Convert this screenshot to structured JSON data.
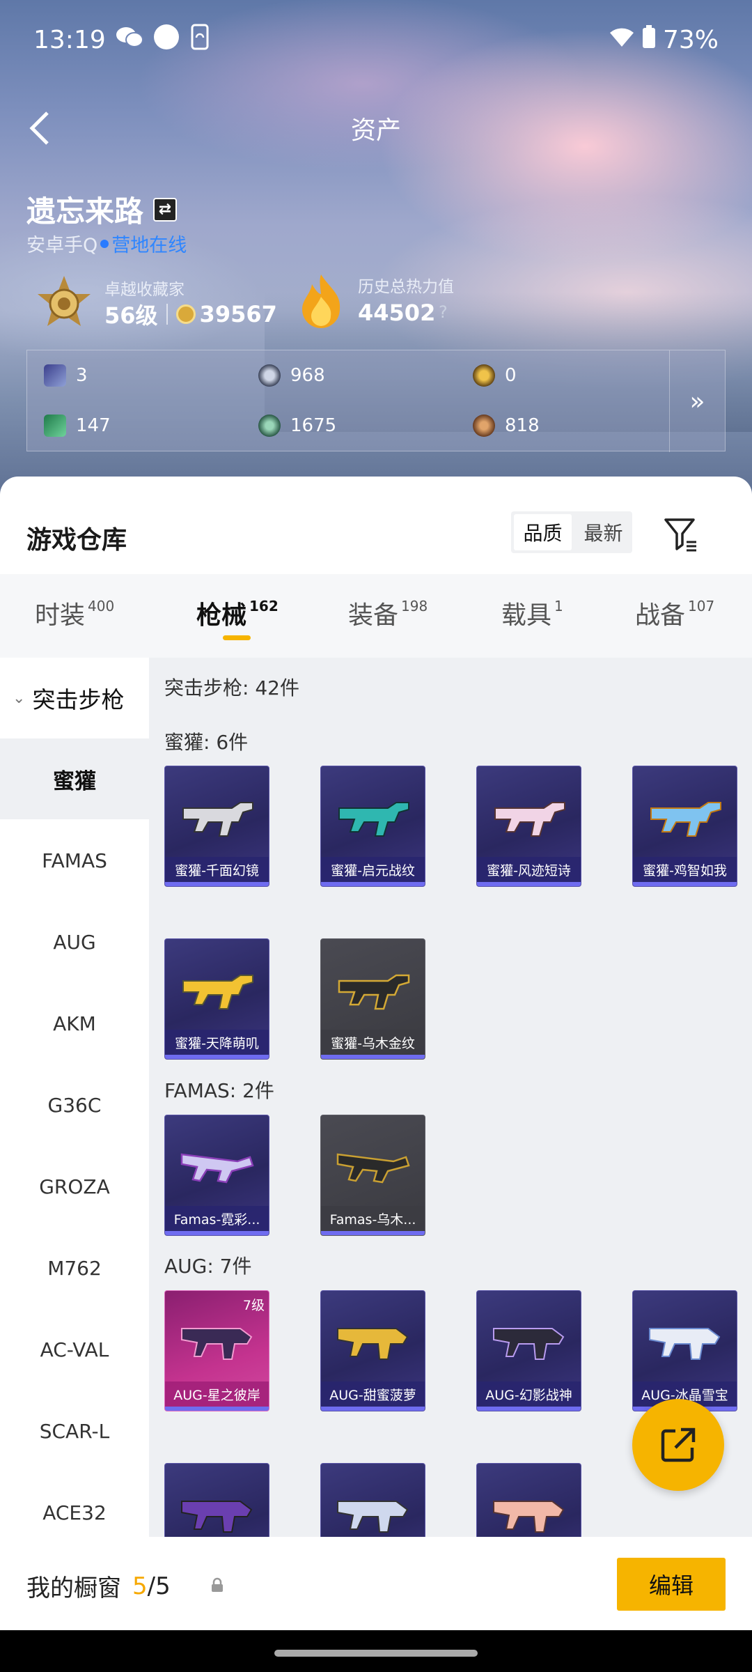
{
  "status_bar": {
    "time": "13:19",
    "battery": "73%"
  },
  "header": {
    "title": "资产"
  },
  "profile": {
    "name": "遗忘来路",
    "platform": "安卓手Q",
    "online_status": "营地在线",
    "rank_caption": "卓越收藏家",
    "rank_level": "56级",
    "coins": "39567",
    "heat_caption": "历史总热力值",
    "heat_value": "44502",
    "heat_help": "?"
  },
  "stats": [
    {
      "icon": "card-icon",
      "value": "3"
    },
    {
      "icon": "silver-token-icon",
      "value": "968"
    },
    {
      "icon": "gold-token-icon",
      "value": "0"
    },
    {
      "icon": "ticket-icon",
      "value": "147"
    },
    {
      "icon": "green-orb-icon",
      "value": "1675"
    },
    {
      "icon": "bronze-orb-icon",
      "value": "818"
    }
  ],
  "warehouse": {
    "title": "游戏仓库",
    "sort_options": [
      "品质",
      "最新"
    ],
    "sort_selected": "品质"
  },
  "tabs": [
    {
      "label": "时装",
      "count": "400"
    },
    {
      "label": "枪械",
      "count": "162"
    },
    {
      "label": "装备",
      "count": "198"
    },
    {
      "label": "载具",
      "count": "1"
    },
    {
      "label": "战备",
      "count": "107"
    }
  ],
  "sidebar": {
    "category": "突击步枪",
    "items": [
      "蜜獾",
      "FAMAS",
      "AUG",
      "AKM",
      "G36C",
      "GROZA",
      "M762",
      "AC-VAL",
      "SCAR-L",
      "ACE32"
    ]
  },
  "content": {
    "category_count": "突击步枪: 42件",
    "groups": [
      {
        "heading": "蜜獾: 6件",
        "items": [
          "蜜獾-千面幻镜",
          "蜜獾-启元战纹",
          "蜜獾-风迹短诗",
          "蜜獾-鸡智如我",
          "蜜獾-天降萌叽",
          "蜜獾-乌木金纹"
        ]
      },
      {
        "heading": "FAMAS: 2件",
        "items": [
          "Famas-霓彩...",
          "Famas-乌木..."
        ]
      },
      {
        "heading": "AUG: 7件",
        "items": [
          "AUG-星之彼岸",
          "AUG-甜蜜菠萝",
          "AUG-幻影战神",
          "AUG-冰晶雪宝"
        ],
        "first_item_level": "7级"
      }
    ]
  },
  "showcase": {
    "label": "我的橱窗",
    "current": "5",
    "total": "5",
    "edit_label": "编辑"
  }
}
